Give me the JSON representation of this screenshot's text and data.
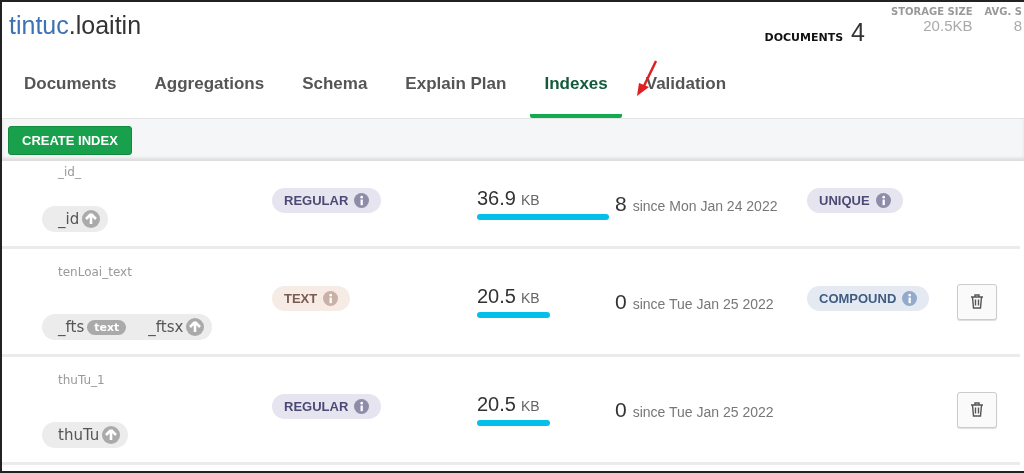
{
  "collection": {
    "database": "tintuc",
    "separator": ".",
    "name": "loaitin"
  },
  "stats": [
    {
      "label": "DOCUMENTS",
      "value": "4",
      "kind": "big"
    },
    {
      "label": "STORAGE SIZE",
      "value": "20.5KB",
      "kind": "small"
    },
    {
      "label": "AVG. S",
      "value": "8",
      "kind": "small"
    }
  ],
  "tabs": [
    {
      "label": "Documents",
      "selected": false
    },
    {
      "label": "Aggregations",
      "selected": false
    },
    {
      "label": "Schema",
      "selected": false
    },
    {
      "label": "Explain Plan",
      "selected": false
    },
    {
      "label": "Indexes",
      "selected": true
    },
    {
      "label": "Validation",
      "selected": false
    }
  ],
  "toolbar": {
    "create_button": "CREATE INDEX"
  },
  "indexes": [
    {
      "name": "_id_",
      "keys": [
        {
          "field": "_id",
          "kind": "asc"
        }
      ],
      "type": {
        "label": "REGULAR",
        "kind": "regular"
      },
      "size": {
        "value": "36.9",
        "unit": "KB"
      },
      "usage": {
        "count": "8",
        "since": "since Mon Jan 24 2022"
      },
      "properties": [
        {
          "label": "UNIQUE",
          "kind": "unique"
        }
      ],
      "deletable": false
    },
    {
      "name": "tenLoai_text",
      "keys": [
        {
          "field": "_fts",
          "kind": "text",
          "tag": "text"
        },
        {
          "field": "_ftsx",
          "kind": "asc"
        }
      ],
      "type": {
        "label": "TEXT",
        "kind": "text"
      },
      "size": {
        "value": "20.5",
        "unit": "KB"
      },
      "usage": {
        "count": "0",
        "since": "since Tue Jan 25 2022"
      },
      "properties": [
        {
          "label": "COMPOUND",
          "kind": "compound"
        }
      ],
      "deletable": true
    },
    {
      "name": "thuTu_1",
      "keys": [
        {
          "field": "thuTu",
          "kind": "asc"
        }
      ],
      "type": {
        "label": "REGULAR",
        "kind": "regular"
      },
      "size": {
        "value": "20.5",
        "unit": "KB"
      },
      "usage": {
        "count": "0",
        "since": "since Tue Jan 25 2022"
      },
      "deletable": true
    }
  ]
}
